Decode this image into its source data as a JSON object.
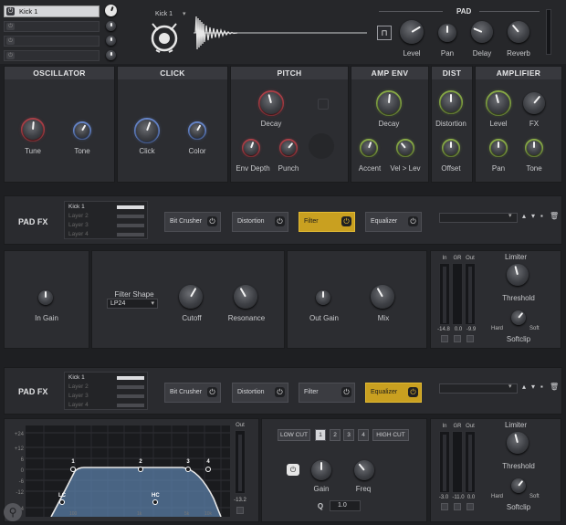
{
  "sample_list": {
    "items": [
      {
        "label": "Kick 1",
        "active": true
      },
      {
        "label": "",
        "active": false
      },
      {
        "label": "",
        "active": false
      },
      {
        "label": "",
        "active": false
      }
    ]
  },
  "sample_selector": {
    "value": "Kick 1"
  },
  "pad": {
    "title": "PAD",
    "knobs": [
      {
        "label": "Level",
        "value": 0.72
      },
      {
        "label": "Pan",
        "value": 0.5
      },
      {
        "label": "Delay",
        "value": 0.25
      },
      {
        "label": "Reverb",
        "value": 0.35
      }
    ]
  },
  "sections": {
    "oscillator": {
      "title": "OSCILLATOR",
      "knobs": [
        "Tune",
        "Tone"
      ]
    },
    "click": {
      "title": "CLICK",
      "knobs": [
        "Click",
        "Color"
      ]
    },
    "pitch": {
      "title": "PITCH",
      "knobs": [
        "Decay",
        "Env Depth",
        "Punch"
      ]
    },
    "amp_env": {
      "title": "AMP ENV",
      "knobs": [
        "Decay",
        "Accent",
        "Vel > Lev"
      ]
    },
    "dist": {
      "title": "DIST",
      "knobs": [
        "Distortion",
        "Offset"
      ]
    },
    "amplifier": {
      "title": "AMPLIFIER",
      "knobs": [
        "Level",
        "FX",
        "Pan",
        "Tone"
      ]
    }
  },
  "pad_fx_1": {
    "title": "PAD FX",
    "layers": [
      "Kick 1",
      "Layer 2",
      "Layer 3",
      "Layer 4"
    ],
    "effects": [
      {
        "label": "Bit Crusher",
        "on": false
      },
      {
        "label": "Distortion",
        "on": false
      },
      {
        "label": "Filter",
        "on": true
      },
      {
        "label": "Equalizer",
        "on": false
      }
    ],
    "in_gain_label": "In Gain",
    "filter_shape_label": "Filter Shape",
    "filter_shape_value": "LP24",
    "cutoff_label": "Cutoff",
    "resonance_label": "Resonance",
    "out_gain_label": "Out Gain",
    "mix_label": "Mix",
    "meter": {
      "in": "In",
      "gr": "GR",
      "out": "Out",
      "in_val": "-14.8",
      "gr_val": "0.0",
      "out_val": "-9.9"
    },
    "limiter": {
      "title": "Limiter",
      "threshold": "Threshold",
      "hard": "Hard",
      "soft": "Soft",
      "softclip": "Softclip"
    }
  },
  "pad_fx_2": {
    "title": "PAD FX",
    "layers": [
      "Kick 1",
      "Layer 2",
      "Layer 3",
      "Layer 4"
    ],
    "effects": [
      {
        "label": "Bit Crusher",
        "on": false
      },
      {
        "label": "Distortion",
        "on": false
      },
      {
        "label": "Filter",
        "on": false
      },
      {
        "label": "Equalizer",
        "on": true
      }
    ],
    "eq_db_labels": [
      "+24",
      "+12",
      "6",
      "0",
      "-6",
      "-12",
      "-24"
    ],
    "eq_freq_labels": [
      "100",
      "1k",
      "5k",
      "10k"
    ],
    "eq_out_label": "Out",
    "eq_out_val": "-13.2",
    "eq_points": [
      "1",
      "2",
      "3",
      "4"
    ],
    "eq_lc": "LC",
    "eq_hc": "HC",
    "band_buttons": [
      "LOW CUT",
      "1",
      "2",
      "3",
      "4",
      "HIGH CUT"
    ],
    "gain_label": "Gain",
    "freq_label": "Freq",
    "q_label": "Q",
    "q_value": "1.0",
    "meter": {
      "in": "In",
      "gr": "GR",
      "out": "Out",
      "in_val": "-3.0",
      "gr_val": "-11.0",
      "out_val": "0.0"
    },
    "limiter": {
      "title": "Limiter",
      "threshold": "Threshold",
      "hard": "Hard",
      "soft": "Soft",
      "softclip": "Softclip"
    }
  },
  "colors": {
    "accent_gold": "#c9a020",
    "ring_red": "#b0424a",
    "ring_blue": "#6a8ad0",
    "ring_green": "#8db04a",
    "eq_fill": "#5a7ea6"
  }
}
